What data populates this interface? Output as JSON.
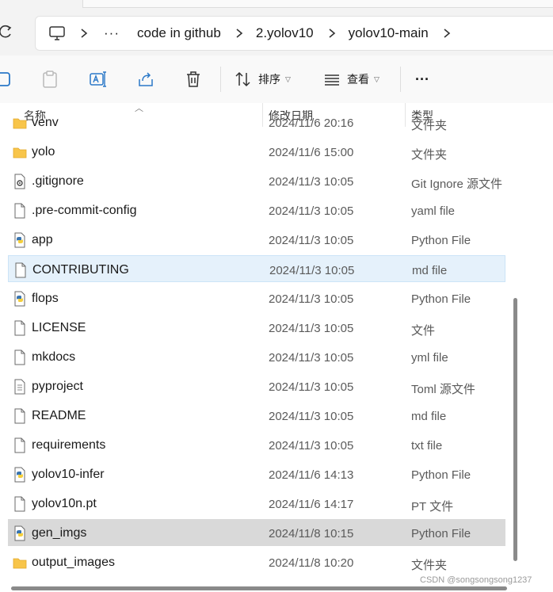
{
  "breadcrumb": {
    "ellipsis": "···",
    "items": [
      "code in github",
      "2.yolov10",
      "yolov10-main"
    ]
  },
  "toolbar": {
    "sort_label": "排序",
    "view_label": "查看",
    "more_label": "···"
  },
  "columns": {
    "name": "名称",
    "date": "修改日期",
    "type": "类型"
  },
  "files": [
    {
      "name": "venv",
      "date": "2024/11/6 20:16",
      "type": "文件夹",
      "icon": "folder-icon"
    },
    {
      "name": "yolo",
      "date": "2024/11/6 15:00",
      "type": "文件夹",
      "icon": "folder-icon"
    },
    {
      "name": ".gitignore",
      "date": "2024/11/3 10:05",
      "type": "Git Ignore 源文件",
      "icon": "settings-file-icon"
    },
    {
      "name": ".pre-commit-config",
      "date": "2024/11/3 10:05",
      "type": "yaml file",
      "icon": "file-icon"
    },
    {
      "name": "app",
      "date": "2024/11/3 10:05",
      "type": "Python File",
      "icon": "python-file-icon"
    },
    {
      "name": "CONTRIBUTING",
      "date": "2024/11/3 10:05",
      "type": "md file",
      "icon": "file-icon"
    },
    {
      "name": "flops",
      "date": "2024/11/3 10:05",
      "type": "Python File",
      "icon": "python-file-icon"
    },
    {
      "name": "LICENSE",
      "date": "2024/11/3 10:05",
      "type": "文件",
      "icon": "file-icon"
    },
    {
      "name": "mkdocs",
      "date": "2024/11/3 10:05",
      "type": "yml file",
      "icon": "file-icon"
    },
    {
      "name": "pyproject",
      "date": "2024/11/3 10:05",
      "type": "Toml 源文件",
      "icon": "text-file-icon"
    },
    {
      "name": "README",
      "date": "2024/11/3 10:05",
      "type": "md file",
      "icon": "file-icon"
    },
    {
      "name": "requirements",
      "date": "2024/11/3 10:05",
      "type": "txt file",
      "icon": "file-icon"
    },
    {
      "name": "yolov10-infer",
      "date": "2024/11/6 14:13",
      "type": "Python File",
      "icon": "python-file-icon"
    },
    {
      "name": "yolov10n.pt",
      "date": "2024/11/6 14:17",
      "type": "PT 文件",
      "icon": "file-icon"
    },
    {
      "name": "gen_imgs",
      "date": "2024/11/8 10:15",
      "type": "Python File",
      "icon": "python-file-icon"
    },
    {
      "name": "output_images",
      "date": "2024/11/8 10:20",
      "type": "文件夹",
      "icon": "folder-icon"
    }
  ],
  "watermark": "CSDN @songsongsong1237",
  "colors": {
    "hover_row": "#e5f1fb",
    "selected_row": "#d9d9d9",
    "folder": "#f8c54a",
    "python_blue": "#3a75b0",
    "python_yellow": "#f5cf3c"
  }
}
